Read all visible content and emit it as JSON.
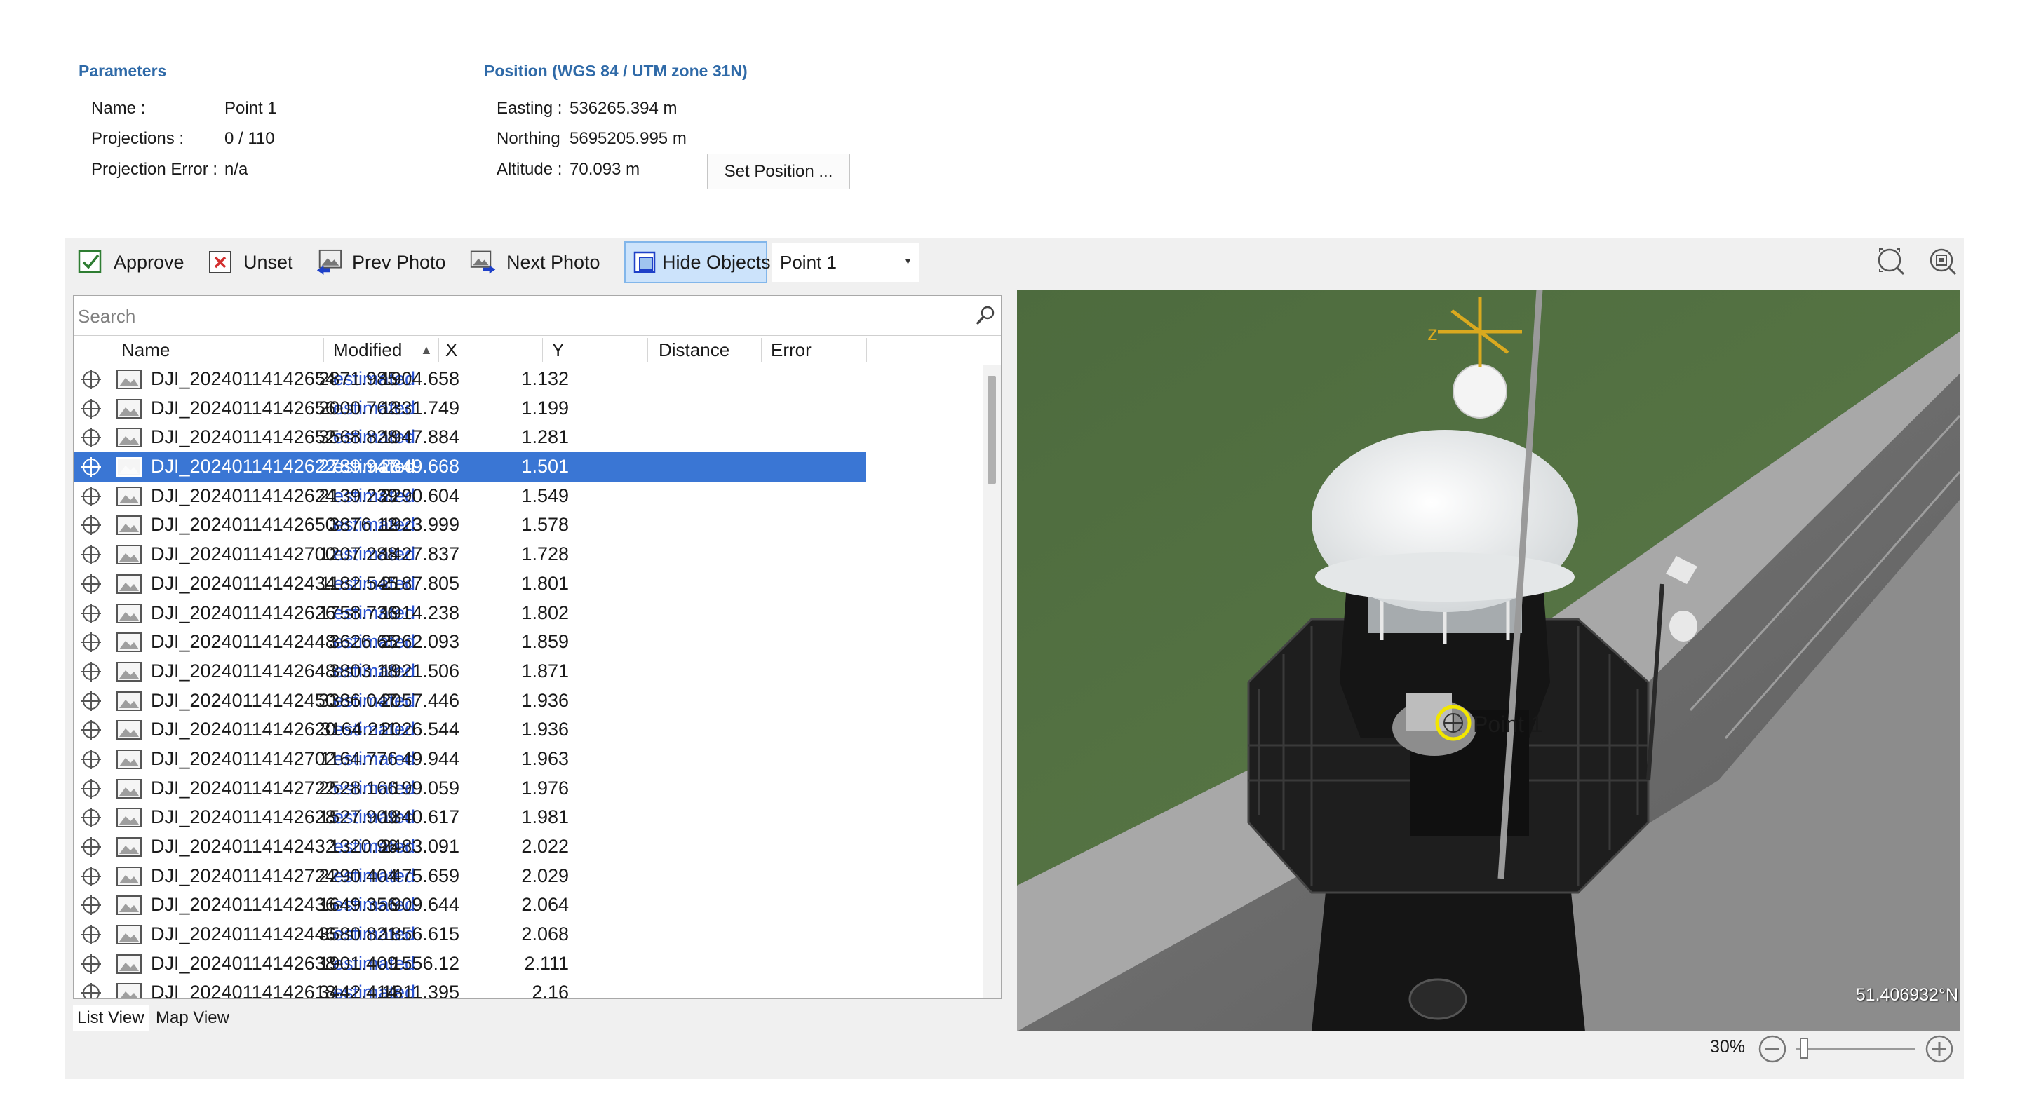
{
  "parameters": {
    "title": "Parameters",
    "name_label": "Name :",
    "name_value": "Point 1",
    "projections_label": "Projections :",
    "projections_value": "0 / 110",
    "projection_error_label": "Projection Error :",
    "projection_error_value": "n/a"
  },
  "position": {
    "title": "Position (WGS 84 / UTM zone 31N)",
    "easting_label": "Easting :",
    "easting_value": "536265.394 m",
    "northing_label": "Northing",
    "northing_value": "5695205.995 m",
    "altitude_label": "Altitude :",
    "altitude_value": "70.093 m",
    "set_position_button": "Set Position ..."
  },
  "toolbar": {
    "approve": "Approve",
    "unset": "Unset",
    "prev_photo": "Prev Photo",
    "next_photo": "Next Photo",
    "hide_objects": "Hide Objects",
    "point_selected": "Point 1"
  },
  "search": {
    "placeholder": "Search"
  },
  "columns": {
    "name": "Name",
    "modified": "Modified",
    "x": "X",
    "y": "Y",
    "distance": "Distance",
    "error": "Error"
  },
  "rows": [
    {
      "name": "DJI_20240114142654",
      "modified": "estimated",
      "x": "2871.985",
      "y": "1904.658",
      "distance": "1.132",
      "error": ""
    },
    {
      "name": "DJI_20240114142656",
      "modified": "estimated",
      "x": "2000.762",
      "y": "1331.749",
      "distance": "1.199",
      "error": ""
    },
    {
      "name": "DJI_20240114142652",
      "modified": "estimated",
      "x": "3568.828",
      "y": "1947.884",
      "distance": "1.281",
      "error": ""
    },
    {
      "name": "DJI_20240114142622",
      "modified": "estimated",
      "x": "2789.947",
      "y": "2849.668",
      "distance": "1.501",
      "error": "",
      "selected": true
    },
    {
      "name": "DJI_20240114142624",
      "modified": "estimated",
      "x": "2139.239",
      "y": "2290.604",
      "distance": "1.549",
      "error": ""
    },
    {
      "name": "DJI_20240114142650",
      "modified": "estimated",
      "x": "3876.12",
      "y": "1923.999",
      "distance": "1.578",
      "error": ""
    },
    {
      "name": "DJI_20240114142700",
      "modified": "estimated",
      "x": "1207.288",
      "y": "1427.837",
      "distance": "1.728",
      "error": ""
    },
    {
      "name": "DJI_20240114142434",
      "modified": "estimated",
      "x": "1182.545",
      "y": "2187.805",
      "distance": "1.801",
      "error": ""
    },
    {
      "name": "DJI_20240114142626",
      "modified": "estimated",
      "x": "1758.736",
      "y": "1914.238",
      "distance": "1.802",
      "error": ""
    },
    {
      "name": "DJI_20240114142448",
      "modified": "estimated",
      "x": "3626.65",
      "y": "2262.093",
      "distance": "1.859",
      "error": ""
    },
    {
      "name": "DJI_20240114142648",
      "modified": "estimated",
      "x": "3803.18",
      "y": "1921.506",
      "distance": "1.871",
      "error": ""
    },
    {
      "name": "DJI_20240114142450",
      "modified": "estimated",
      "x": "3386.047",
      "y": "2057.446",
      "distance": "1.936",
      "error": ""
    },
    {
      "name": "DJI_20240114142620",
      "modified": "estimated",
      "x": "3164.211",
      "y": "2026.544",
      "distance": "1.936",
      "error": ""
    },
    {
      "name": "DJI_20240114142702",
      "modified": "estimated",
      "x": "1164.776",
      "y": "49.944",
      "distance": "1.963",
      "error": ""
    },
    {
      "name": "DJI_20240114142722",
      "modified": "estimated",
      "x": "2528.166",
      "y": "199.059",
      "distance": "1.976",
      "error": ""
    },
    {
      "name": "DJI_20240114142628",
      "modified": "estimated",
      "x": "1527.909",
      "y": "1840.617",
      "distance": "1.981",
      "error": ""
    },
    {
      "name": "DJI_20240114142432",
      "modified": "estimated",
      "x": "1320.96",
      "y": "2483.091",
      "distance": "2.022",
      "error": ""
    },
    {
      "name": "DJI_20240114142724",
      "modified": "estimated",
      "x": "2290.404",
      "y": "475.659",
      "distance": "2.029",
      "error": ""
    },
    {
      "name": "DJI_20240114142436",
      "modified": "estimated",
      "x": "1649.356",
      "y": "909.644",
      "distance": "2.064",
      "error": ""
    },
    {
      "name": "DJI_20240114142446",
      "modified": "estimated",
      "x": "3580.821",
      "y": "1856.615",
      "distance": "2.068",
      "error": ""
    },
    {
      "name": "DJI_20240114142638",
      "modified": "estimated",
      "x": "1901.409",
      "y": "1556.12",
      "distance": "2.111",
      "error": ""
    },
    {
      "name": "DJI_20240114142618",
      "modified": "estimated",
      "x": "3442.414",
      "y": "1811.395",
      "distance": "2.16",
      "error": ""
    }
  ],
  "tabs": {
    "list_view": "List View",
    "map_view": "Map View"
  },
  "photo": {
    "marker_label": "Point 1",
    "coordinate_overlay": "51.406932°N",
    "zoom_percent": "30%",
    "zoom_level": 0.04
  },
  "colors": {
    "accent": "#2f6aa8",
    "selection": "#3a76d4",
    "link": "#2b53d0",
    "marker": "#f2e600"
  }
}
